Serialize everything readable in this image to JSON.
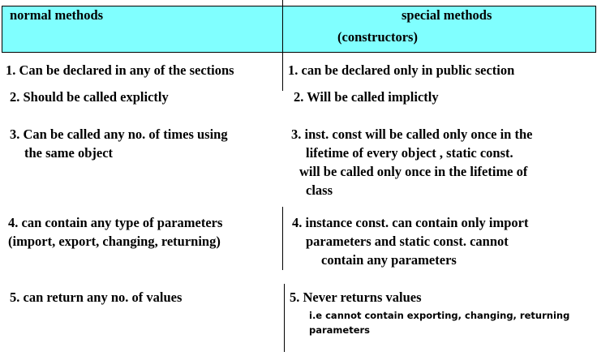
{
  "header": {
    "left": "normal methods",
    "right_line1": "special  methods",
    "right_line2": "(constructors)"
  },
  "rows": [
    {
      "left": [
        "1. Can be declared in any of the sections"
      ],
      "right": [
        "1. can be declared only in public section"
      ]
    },
    {
      "left": [
        "2. Should be called explictly"
      ],
      "right": [
        "2. Will be called implictly"
      ]
    },
    {
      "left": [
        "3. Can be called any no. of times using",
        "the same object"
      ],
      "right": [
        "3. inst. const will be called only once in the",
        "lifetime of every object , static const.",
        "will be called only once in the lifetime of",
        "class"
      ]
    },
    {
      "left": [
        "4. can contain any type of parameters",
        "(import, export, changing, returning)"
      ],
      "right": [
        "4. instance const. can contain only import",
        "parameters and static const. cannot",
        "contain any parameters"
      ]
    },
    {
      "left": [
        "5. can return any no. of values"
      ],
      "right": [
        "5. Never returns values"
      ],
      "note": [
        "i.e cannot contain exporting, changing, returning",
        "parameters"
      ]
    }
  ]
}
